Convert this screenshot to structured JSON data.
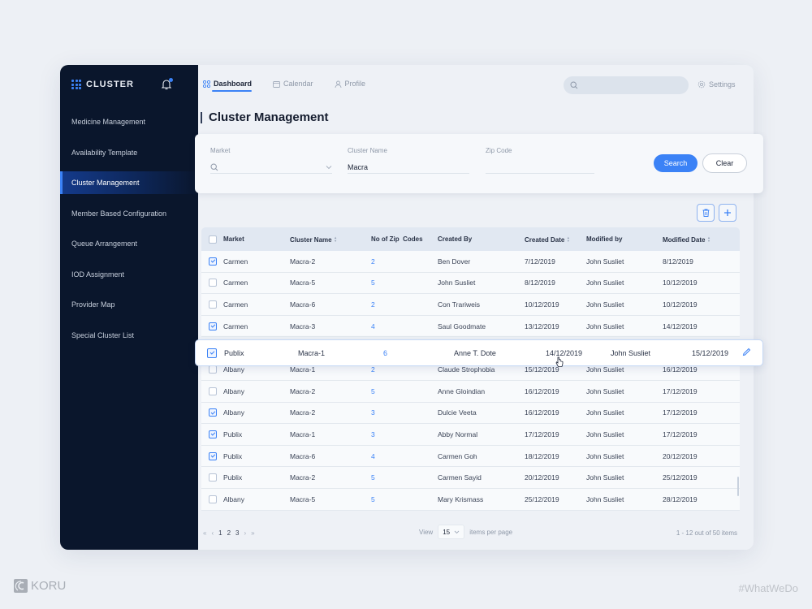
{
  "app": {
    "logo_text": "CLUSTER"
  },
  "sidebar": {
    "items": [
      {
        "label": "Medicine Management",
        "active": false
      },
      {
        "label": "Availability Template",
        "active": false
      },
      {
        "label": "Cluster Management",
        "active": true
      },
      {
        "label": "Member Based Configuration",
        "active": false
      },
      {
        "label": "Queue Arrangement",
        "active": false
      },
      {
        "label": "IOD Assignment",
        "active": false
      },
      {
        "label": "Provider Map",
        "active": false
      },
      {
        "label": "Special Cluster List",
        "active": false
      }
    ]
  },
  "header": {
    "tabs": [
      {
        "label": "Dashboard",
        "icon": "grid-icon",
        "active": true
      },
      {
        "label": "Calendar",
        "icon": "calendar-icon",
        "active": false
      },
      {
        "label": "Profile",
        "icon": "user-icon",
        "active": false
      }
    ],
    "search_placeholder": "",
    "settings_label": "Settings"
  },
  "page": {
    "title": "Cluster Management"
  },
  "filters": {
    "market": {
      "label": "Market",
      "value": ""
    },
    "cluster_name": {
      "label": "Cluster Name",
      "value": "Macra"
    },
    "zip_code": {
      "label": "Zip Code",
      "value": ""
    },
    "search_label": "Search",
    "clear_label": "Clear"
  },
  "table": {
    "columns": [
      "Market",
      "Cluster Name",
      "No of Zip  Codes",
      "Created By",
      "Created Date",
      "Modified by",
      "Modified Date"
    ],
    "sortable": [
      false,
      true,
      false,
      false,
      true,
      false,
      true
    ],
    "rows": [
      {
        "checked": true,
        "market": "Carmen",
        "cluster": "Macra-2",
        "zips": "2",
        "created_by": "Ben Dover",
        "created_date": "7/12/2019",
        "modified_by": "John Susliet",
        "modified_date": "8/12/2019"
      },
      {
        "checked": false,
        "market": "Carmen",
        "cluster": "Macra-5",
        "zips": "5",
        "created_by": "John Susliet",
        "created_date": "8/12/2019",
        "modified_by": "John Susliet",
        "modified_date": "10/12/2019"
      },
      {
        "checked": false,
        "market": "Carmen",
        "cluster": "Macra-6",
        "zips": "2",
        "created_by": "Con Trariweis",
        "created_date": "10/12/2019",
        "modified_by": "John Susliet",
        "modified_date": "10/12/2019"
      },
      {
        "checked": true,
        "market": "Carmen",
        "cluster": "Macra-3",
        "zips": "4",
        "created_by": "Saul Goodmate",
        "created_date": "13/12/2019",
        "modified_by": "John Susliet",
        "modified_date": "14/12/2019"
      },
      {
        "checked": true,
        "market": "Publix",
        "cluster": "Macra-1",
        "zips": "6",
        "created_by": "Anne T. Dote",
        "created_date": "14/12/2019",
        "modified_by": "John Susliet",
        "modified_date": "15/12/2019",
        "highlighted": true
      },
      {
        "checked": false,
        "market": "Albany",
        "cluster": "Macra-1",
        "zips": "2",
        "created_by": "Claude Strophobia",
        "created_date": "15/12/2019",
        "modified_by": "John Susliet",
        "modified_date": "16/12/2019"
      },
      {
        "checked": false,
        "market": "Albany",
        "cluster": "Macra-2",
        "zips": "5",
        "created_by": "Anne Gloindian",
        "created_date": "16/12/2019",
        "modified_by": "John Susliet",
        "modified_date": "17/12/2019"
      },
      {
        "checked": true,
        "market": "Albany",
        "cluster": "Macra-2",
        "zips": "3",
        "created_by": "Dulcie Veeta",
        "created_date": "16/12/2019",
        "modified_by": "John Susliet",
        "modified_date": "17/12/2019"
      },
      {
        "checked": true,
        "market": "Publix",
        "cluster": "Macra-1",
        "zips": "3",
        "created_by": "Abby Normal",
        "created_date": "17/12/2019",
        "modified_by": "John Susliet",
        "modified_date": "17/12/2019"
      },
      {
        "checked": true,
        "market": "Publix",
        "cluster": "Macra-6",
        "zips": "4",
        "created_by": "Carmen Goh",
        "created_date": "18/12/2019",
        "modified_by": "John Susliet",
        "modified_date": "20/12/2019"
      },
      {
        "checked": false,
        "market": "Publix",
        "cluster": "Macra-2",
        "zips": "5",
        "created_by": "Carmen Sayid",
        "created_date": "20/12/2019",
        "modified_by": "John Susliet",
        "modified_date": "25/12/2019"
      },
      {
        "checked": false,
        "market": "Albany",
        "cluster": "Macra-5",
        "zips": "5",
        "created_by": "Mary Krismass",
        "created_date": "25/12/2019",
        "modified_by": "John Susliet",
        "modified_date": "28/12/2019"
      }
    ]
  },
  "pagination": {
    "pages": [
      "1",
      "2",
      "3"
    ],
    "current_page": "1",
    "view_label": "View",
    "per_page": "15",
    "per_page_suffix": "items per page",
    "summary": "1 - 12 out of 50 items"
  },
  "footer": {
    "brand": "KORU",
    "hashtag": "#WhatWeDo"
  },
  "colors": {
    "accent": "#3b82f6",
    "sidebar_bg": "#0a162c",
    "page_bg": "#edf0f5"
  }
}
